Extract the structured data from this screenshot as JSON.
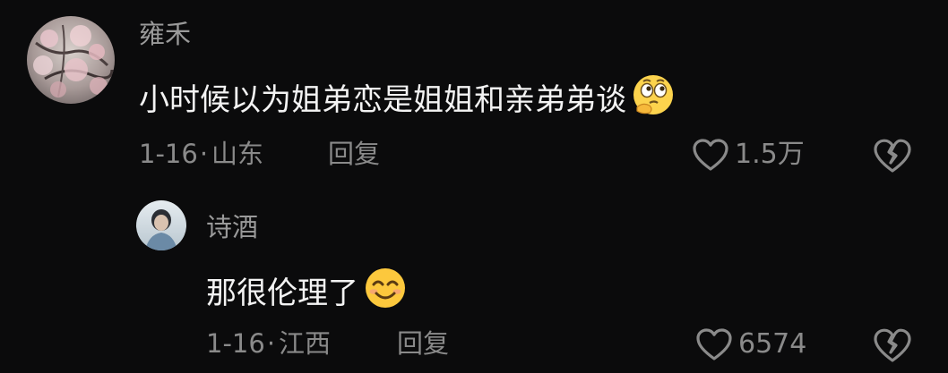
{
  "comments": [
    {
      "username": "雍禾",
      "text": "小时候以为姐弟恋是姐姐和亲弟弟谈",
      "emoji": "thinking-face-emoji",
      "date": "1-16",
      "separator": "·",
      "location": "山东",
      "reply_label": "回复",
      "like_count": "1.5万",
      "avatar": "cherry-blossom-photo"
    },
    {
      "username": "诗酒",
      "text": "那很伦理了",
      "emoji": "smiling-face-emoji",
      "date": "1-16",
      "separator": "·",
      "location": "江西",
      "reply_label": "回复",
      "like_count": "6574",
      "avatar": "person-photo"
    }
  ],
  "icons": {
    "like": "heart-outline-icon",
    "dislike": "broken-heart-icon"
  },
  "colors": {
    "background": "#0b0b0c",
    "primary_text": "#f3f3f3",
    "secondary_text": "#8a8a8a"
  }
}
